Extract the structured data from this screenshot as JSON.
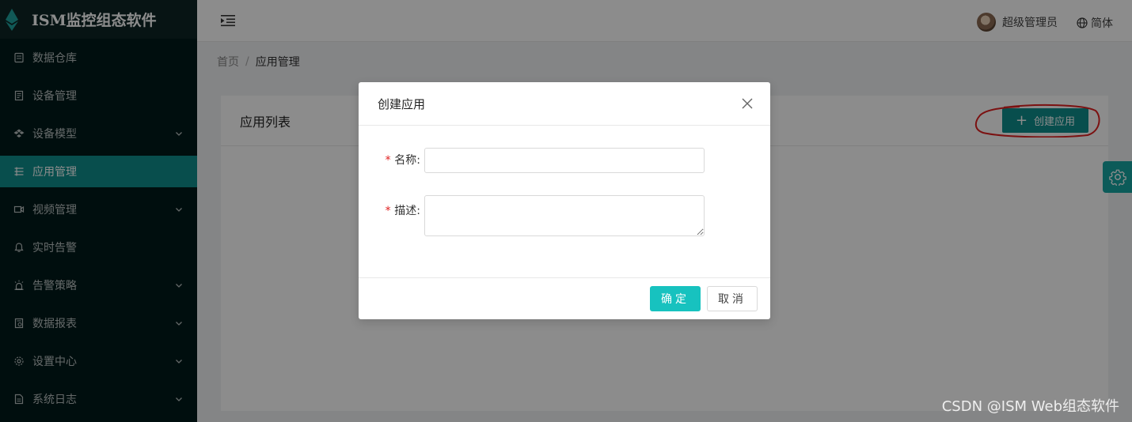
{
  "app": {
    "title": "ISM监控组态软件"
  },
  "sidebar": {
    "items": [
      {
        "label": "数据仓库",
        "icon": "database-icon",
        "has_children": false,
        "active": false
      },
      {
        "label": "设备管理",
        "icon": "device-icon",
        "has_children": false,
        "active": false
      },
      {
        "label": "设备模型",
        "icon": "model-icon",
        "has_children": true,
        "active": false
      },
      {
        "label": "应用管理",
        "icon": "app-list-icon",
        "has_children": false,
        "active": true
      },
      {
        "label": "视频管理",
        "icon": "video-icon",
        "has_children": true,
        "active": false
      },
      {
        "label": "实时告警",
        "icon": "bell-icon",
        "has_children": false,
        "active": false
      },
      {
        "label": "告警策略",
        "icon": "alarm-icon",
        "has_children": true,
        "active": false
      },
      {
        "label": "数据报表",
        "icon": "report-icon",
        "has_children": true,
        "active": false
      },
      {
        "label": "设置中心",
        "icon": "gear-icon",
        "has_children": true,
        "active": false
      },
      {
        "label": "系统日志",
        "icon": "log-icon",
        "has_children": true,
        "active": false
      }
    ]
  },
  "header": {
    "user_name": "超级管理员",
    "language": "简体"
  },
  "breadcrumb": {
    "home": "首页",
    "separator": "/",
    "current": "应用管理"
  },
  "card": {
    "title": "应用列表",
    "create_button": "创建应用"
  },
  "modal": {
    "title": "创建应用",
    "fields": {
      "name_label": "名称:",
      "name_value": "",
      "desc_label": "描述:",
      "desc_value": ""
    },
    "required_mark": "*",
    "ok_label": "确定",
    "cancel_label": "取消"
  },
  "watermark": "CSDN @ISM Web组态软件",
  "colors": {
    "sidebar_bg": "#001a1a",
    "accent": "#0f8f8c",
    "ok_button": "#17c2bf",
    "annotation": "#e02020"
  }
}
